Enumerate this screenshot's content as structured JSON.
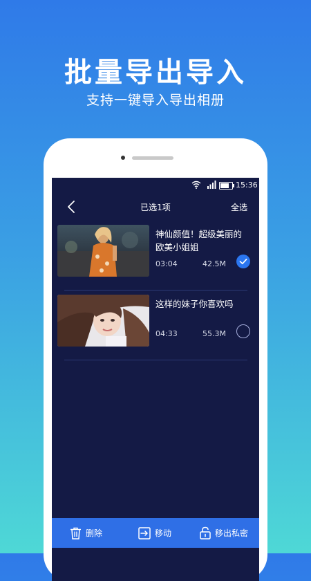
{
  "promo": {
    "title": "批量导出导入",
    "subtitle": "支持一键导入导出相册"
  },
  "status_bar": {
    "time": "15:36",
    "battery_level": 0.75
  },
  "nav": {
    "title": "已选1项",
    "select_all_label": "全选"
  },
  "videos": [
    {
      "title": "神仙颜值！超级美丽的欧美小姐姐",
      "duration": "03:04",
      "size": "42.5M",
      "selected": true
    },
    {
      "title": "这样的妹子你喜欢吗",
      "duration": "04:33",
      "size": "55.3M",
      "selected": false
    }
  ],
  "toolbar": {
    "delete_label": "删除",
    "move_label": "移动",
    "unlock_label": "移出私密"
  },
  "colors": {
    "screen_bg": "#141a45",
    "toolbar_bg": "#2f6fe6",
    "check_on": "#2b76f0"
  }
}
